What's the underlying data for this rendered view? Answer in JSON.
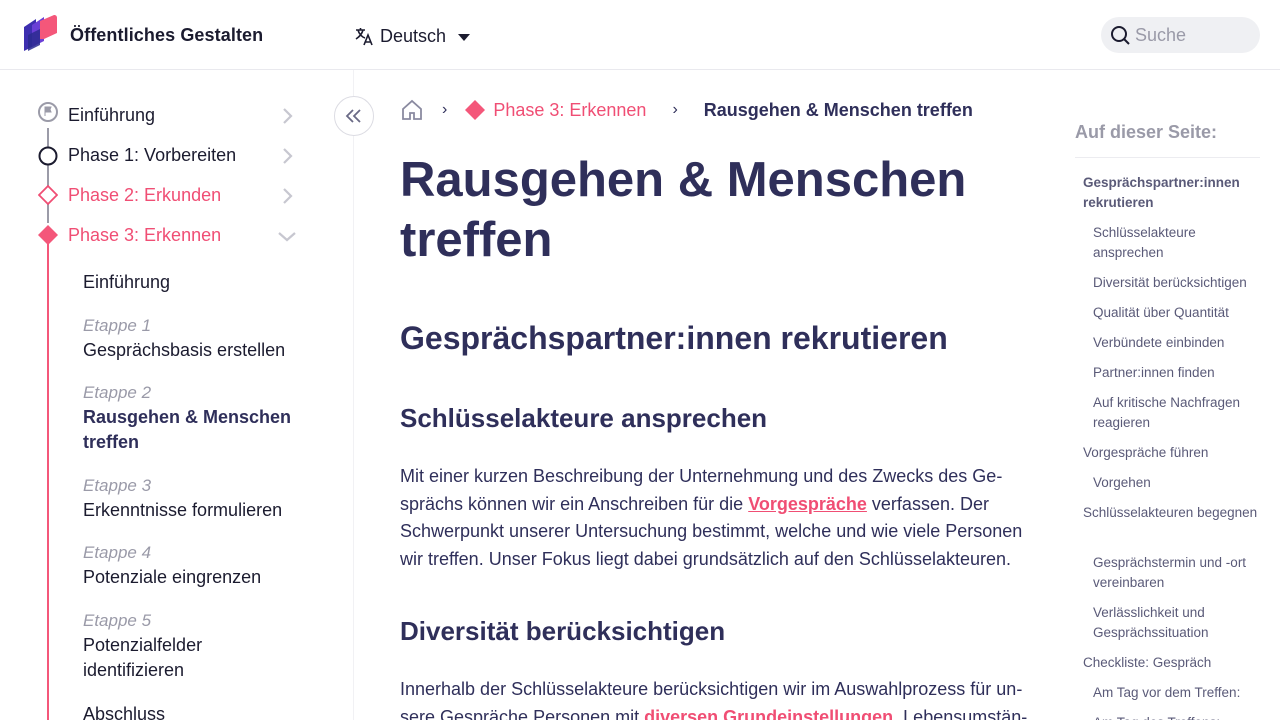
{
  "header": {
    "brand": "Öffentliches Gestalten",
    "language": "Deutsch",
    "search_placeholder": "Suche"
  },
  "sidebar": {
    "phases": [
      {
        "label": "Einführung"
      },
      {
        "label": "Phase 1: Vorbereiten"
      },
      {
        "label": "Phase 2: Erkunden"
      },
      {
        "label": "Phase 3: Erkennen"
      }
    ],
    "subitems": [
      {
        "stage": "",
        "title": "Einführung"
      },
      {
        "stage": "Etappe 1",
        "title": "Gesprächsbasis erstellen"
      },
      {
        "stage": "Etappe 2",
        "title": "Rausgehen & Menschen treffen"
      },
      {
        "stage": "Etappe 3",
        "title": "Erkenntnisse formulieren"
      },
      {
        "stage": "Etappe 4",
        "title": "Potenziale eingrenzen"
      },
      {
        "stage": "Etappe 5",
        "title": "Potenzialfelder identifizieren"
      },
      {
        "stage": "",
        "title": "Abschluss"
      }
    ],
    "colors": {
      "accent": "#f04e74",
      "inactive": "#9b9ba8"
    }
  },
  "breadcrumb": {
    "phase": "Phase 3: Erkennen",
    "current": "Rausgehen & Menschen treffen"
  },
  "main": {
    "title": "Rausgehen & Menschen treffen",
    "h2": "Gesprächspartner:innen rekrutieren",
    "section1": {
      "heading": "Schlüsselakteure ansprechen",
      "text_a": "Mit einer kurzen Beschreibung der Unternehmung und des Zwecks des Ge­sprächs können wir ein Anschreiben für die ",
      "link": "Vorgespräche",
      "text_b": " verfassen. Der Schwerpunkt unserer Untersuchung bestimmt, welche und wie viele Personen wir treffen. Unser Fokus liegt dabei grundsätzlich auf den Schlüsselakteuren."
    },
    "section2": {
      "heading": "Diversität berücksichtigen",
      "text_a": "Innerhalb der Schlüsselakteure berücksichtigen wir im Auswahlprozess für un­sere Gespräche Personen mit ",
      "link": "diversen Grundeinstellungen",
      "text_b": ". Lebensumstän-"
    }
  },
  "toc": {
    "title": "Auf dieser Seite:",
    "items": [
      {
        "label": "Gesprächspartner:innen rekrutieren",
        "level": 1
      },
      {
        "label": "Schlüsselakteure ansprechen",
        "level": 2
      },
      {
        "label": "Diversität berücksichtigen",
        "level": 2
      },
      {
        "label": "Qualität über Quantität",
        "level": 2
      },
      {
        "label": "Verbündete einbinden",
        "level": 2
      },
      {
        "label": "Partner:innen finden",
        "level": 2
      },
      {
        "label": "Auf kritische Nachfragen reagieren",
        "level": 2
      },
      {
        "label": "Vorgespräche führen",
        "level": 1
      },
      {
        "label": "Vorgehen",
        "level": 2
      },
      {
        "label": "Schlüsselakteuren begegnen",
        "level": 1
      },
      {
        "label": "Gesprächstermin und -ort vereinbaren",
        "level": 2
      },
      {
        "label": "Verlässlichkeit und Gesprächssituation",
        "level": 2
      },
      {
        "label": "Checkliste: Gespräch",
        "level": 1
      },
      {
        "label": "Am Tag vor dem Treffen:",
        "level": 2
      },
      {
        "label": "Am Tag des Treffens:",
        "level": 2
      }
    ]
  }
}
